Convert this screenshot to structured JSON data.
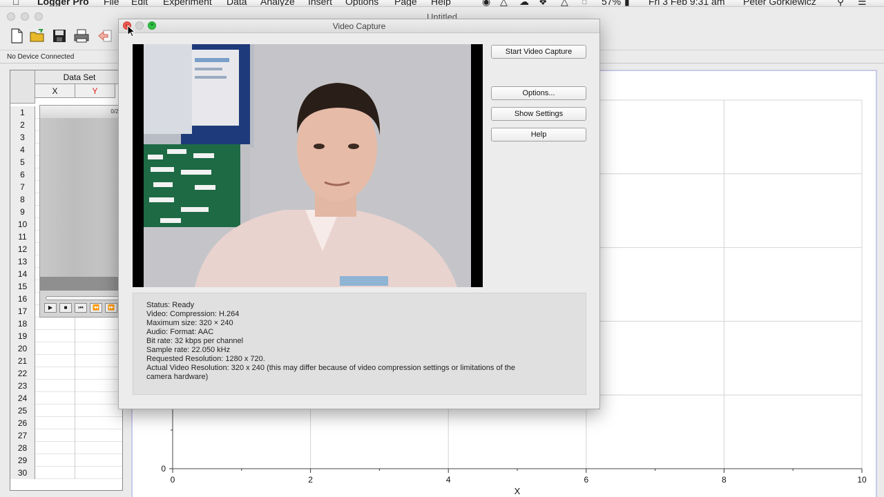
{
  "menubar": {
    "app_name": "Logger Pro",
    "items": [
      "File",
      "Edit",
      "Experiment",
      "Data",
      "Analyze",
      "Insert",
      "Options",
      "Page",
      "Help"
    ],
    "battery": "57%",
    "datetime": "Fri 3 Feb  9:31 am",
    "user": "Peter Gorkiewicz"
  },
  "window": {
    "title": "Untitled"
  },
  "status_bar": {
    "device_status": "No Device Connected"
  },
  "data_table": {
    "title": "Data Set",
    "columns": [
      "X",
      "Y"
    ],
    "column_colors": [
      "#111111",
      "#e0201b"
    ],
    "row_numbers": [
      "1",
      "2",
      "3",
      "4",
      "5",
      "6",
      "7",
      "8",
      "9",
      "10",
      "11",
      "12",
      "13",
      "14",
      "15",
      "16",
      "17",
      "18",
      "19",
      "20",
      "21",
      "22",
      "23",
      "24",
      "25",
      "26",
      "27",
      "28",
      "29",
      "30"
    ],
    "movie_frame_counter": "0/20"
  },
  "graph": {
    "x_label": "X",
    "x_ticks": [
      "0",
      "2",
      "4",
      "6",
      "8",
      "10"
    ],
    "y_zero_label": "0",
    "x_range": [
      0,
      10
    ],
    "grid": true
  },
  "dialog": {
    "title": "Video Capture",
    "buttons": {
      "start": "Start Video Capture",
      "options": "Options...",
      "show_settings": "Show Settings",
      "help": "Help"
    },
    "info": [
      "Status: Ready",
      "Video: Compression: H.264",
      "Maximum size: 320 × 240",
      "Audio: Format: AAC",
      "Bit rate: 32 kbps per channel",
      "Sample rate: 22.050 kHz",
      "Requested Resolution: 1280 x 720.",
      "Actual Video Resolution: 320 x 240 (this may differ because of video compression settings or limitations of the",
      "camera hardware)"
    ]
  },
  "colors": {
    "close_button": "#ee5a52",
    "zoom_button": "#32c146",
    "graph_border": "#c9c9e8"
  }
}
